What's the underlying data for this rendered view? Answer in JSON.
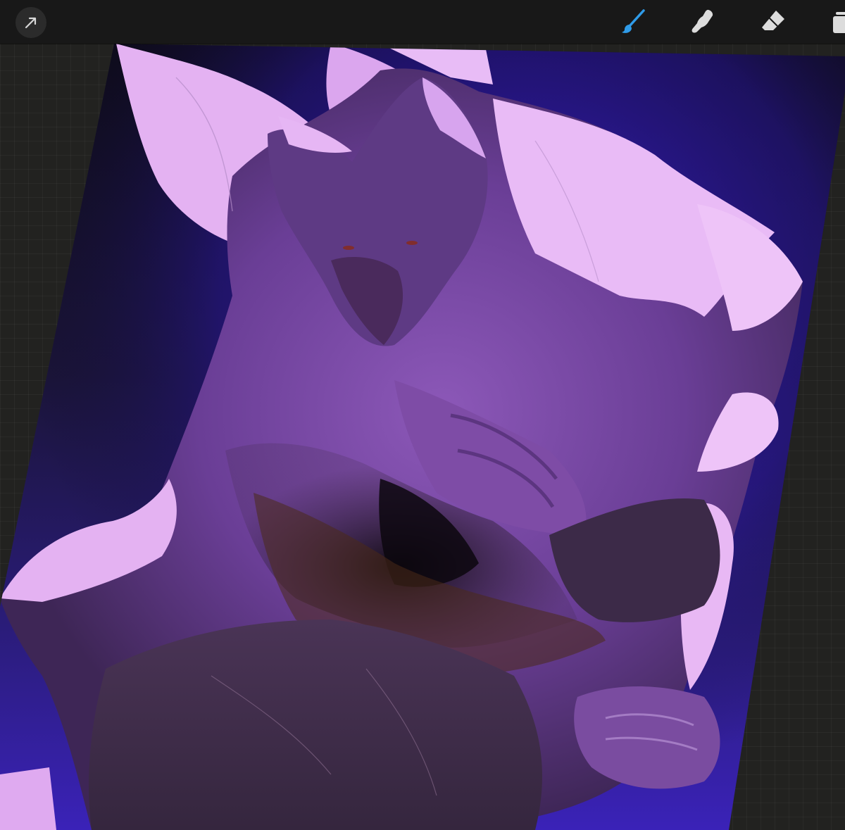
{
  "toolbar": {
    "tools": [
      {
        "name": "transform",
        "icon": "arrow-cursor-icon",
        "active": false
      },
      {
        "name": "paint",
        "icon": "brush-icon",
        "active": true
      },
      {
        "name": "smudge",
        "icon": "smudge-finger-icon",
        "active": false
      },
      {
        "name": "erase",
        "icon": "eraser-icon",
        "active": false
      },
      {
        "name": "layers",
        "icon": "layers-icon",
        "active": false
      }
    ],
    "active_color": "#2f9be8",
    "icon_color": "#dcdcdc"
  },
  "canvas": {
    "artwork": "digital-painting-in-progress",
    "palette": {
      "background_dark": "#0f0c1c",
      "rim_light_blue": "#3a22c8",
      "highlight_pink": "#e6b6f4",
      "midtone_purple": "#7a46a8",
      "shadow_purple": "#3a2550",
      "warm_shadow": "#4a2a18"
    }
  }
}
